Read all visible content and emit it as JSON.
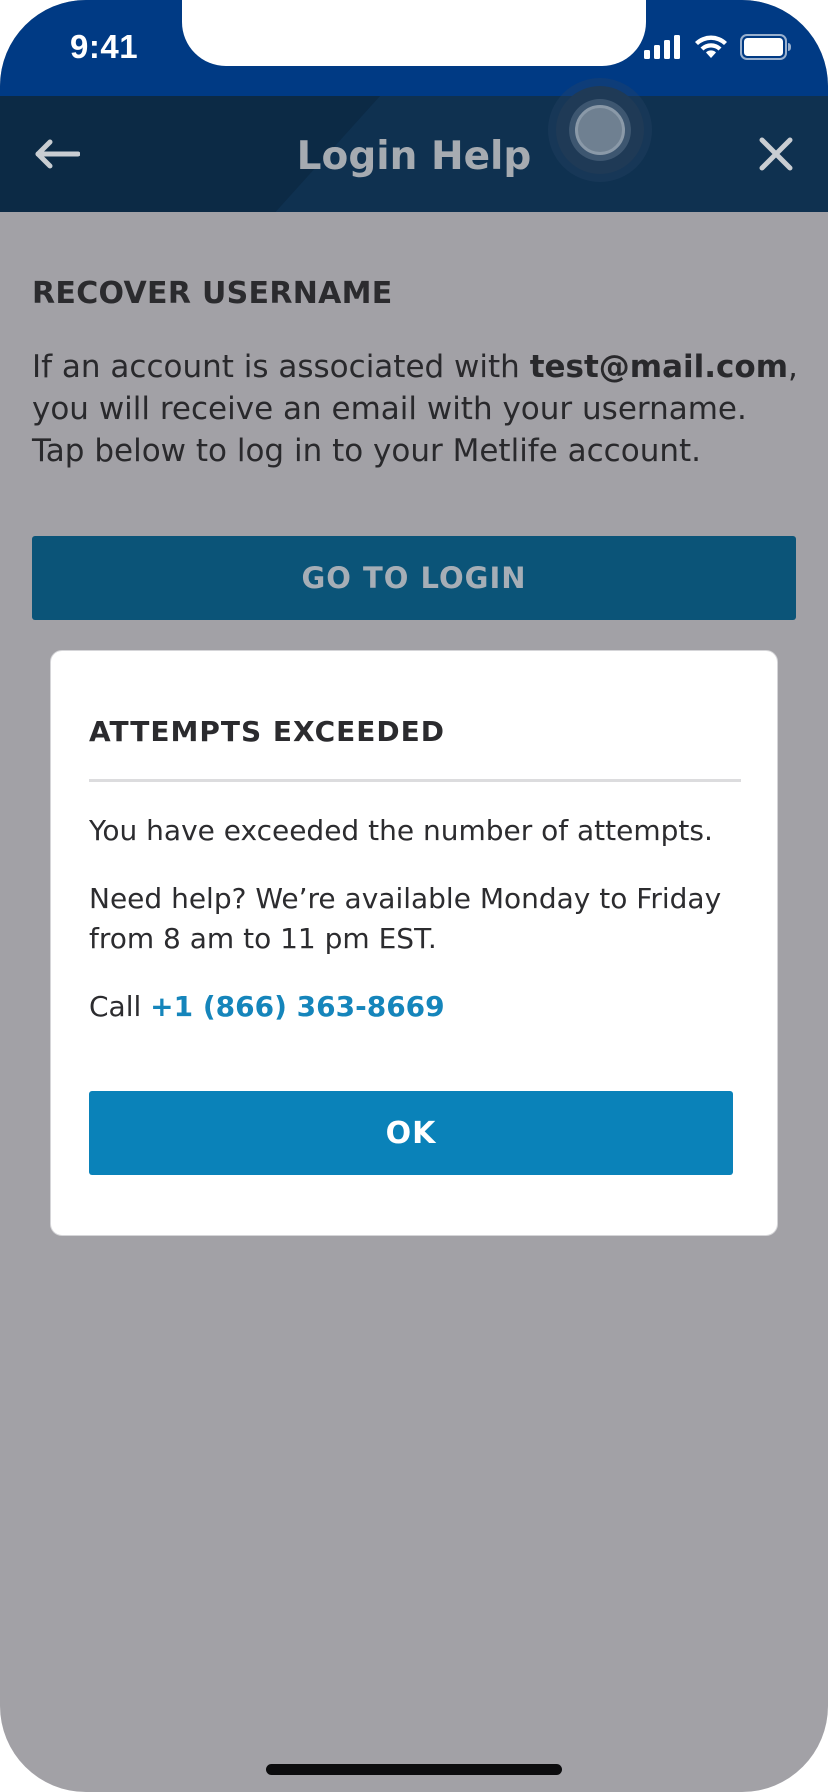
{
  "status_bar": {
    "time": "9:41"
  },
  "header": {
    "title": "Login Help",
    "back_icon": "arrow-left-icon",
    "close_icon": "close-icon"
  },
  "content": {
    "section_heading": "RECOVER USERNAME",
    "body_prefix": "If an account is associated with ",
    "email": "test@mail.com",
    "body_suffix": ", you will receive an email with your username. Tap below to log in to your Metlife account.",
    "go_login_label": "GO TO LOGIN"
  },
  "modal": {
    "title": "ATTEMPTS EXCEEDED",
    "message": "You have exceeded the number of attempts.",
    "help_text": "Need help? We’re available Monday to Friday from 8 am to 11 pm EST.",
    "call_prefix": "Call ",
    "phone": "+1 (866) 363-8669",
    "ok_label": "OK"
  },
  "colors": {
    "status_bar": "#003a84",
    "header": "#0c2a45",
    "overlay": "#a2a1a6",
    "primary_button": "#0a82b9",
    "link": "#1585bb"
  }
}
